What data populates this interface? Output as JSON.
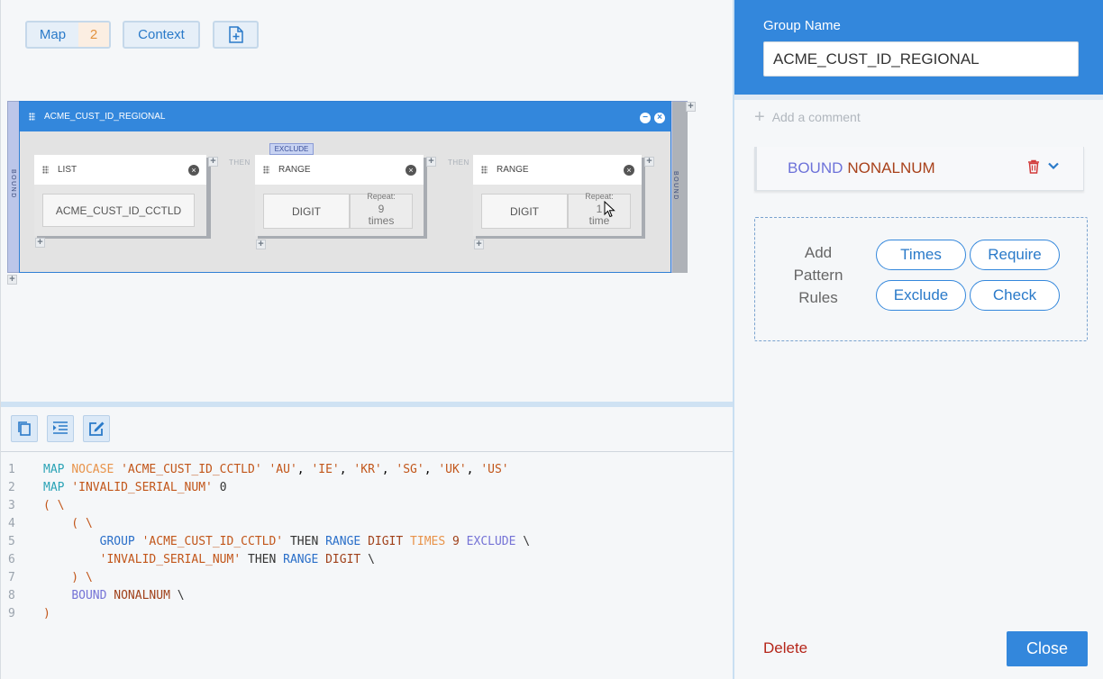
{
  "toolbar": {
    "map_label": "Map",
    "map_count": "2",
    "context_label": "Context",
    "add_icon": "add-document-icon"
  },
  "group": {
    "name": "ACME_CUST_ID_REGIONAL",
    "side_label": "BOUND",
    "exclude_tag": "EXCLUDE",
    "then_label": "THEN",
    "nodes": [
      {
        "type": "LIST",
        "value": "ACME_CUST_ID_CCTLD"
      },
      {
        "type": "RANGE",
        "value": "DIGIT",
        "repeat_label": "Repeat:",
        "repeat_count": "9",
        "repeat_unit": "times"
      },
      {
        "type": "RANGE",
        "value": "DIGIT",
        "repeat_label": "Repeat:",
        "repeat_count": "1",
        "repeat_unit": "time"
      }
    ]
  },
  "code": {
    "line_numbers": [
      "1",
      "2",
      "3",
      "4",
      "5",
      "6",
      "7",
      "8",
      "9"
    ]
  },
  "panel": {
    "group_name_label": "Group Name",
    "group_name_value": "ACME_CUST_ID_REGIONAL",
    "add_comment": "Add a comment",
    "bound_keyword": "BOUND",
    "bound_value": "NONALNUM",
    "rules_label": "Add Pattern Rules",
    "rule_buttons": [
      "Times",
      "Require",
      "Exclude",
      "Check"
    ],
    "delete_label": "Delete",
    "close_label": "Close"
  },
  "colors": {
    "accent": "#3387dc",
    "delete": "#b5261a"
  }
}
